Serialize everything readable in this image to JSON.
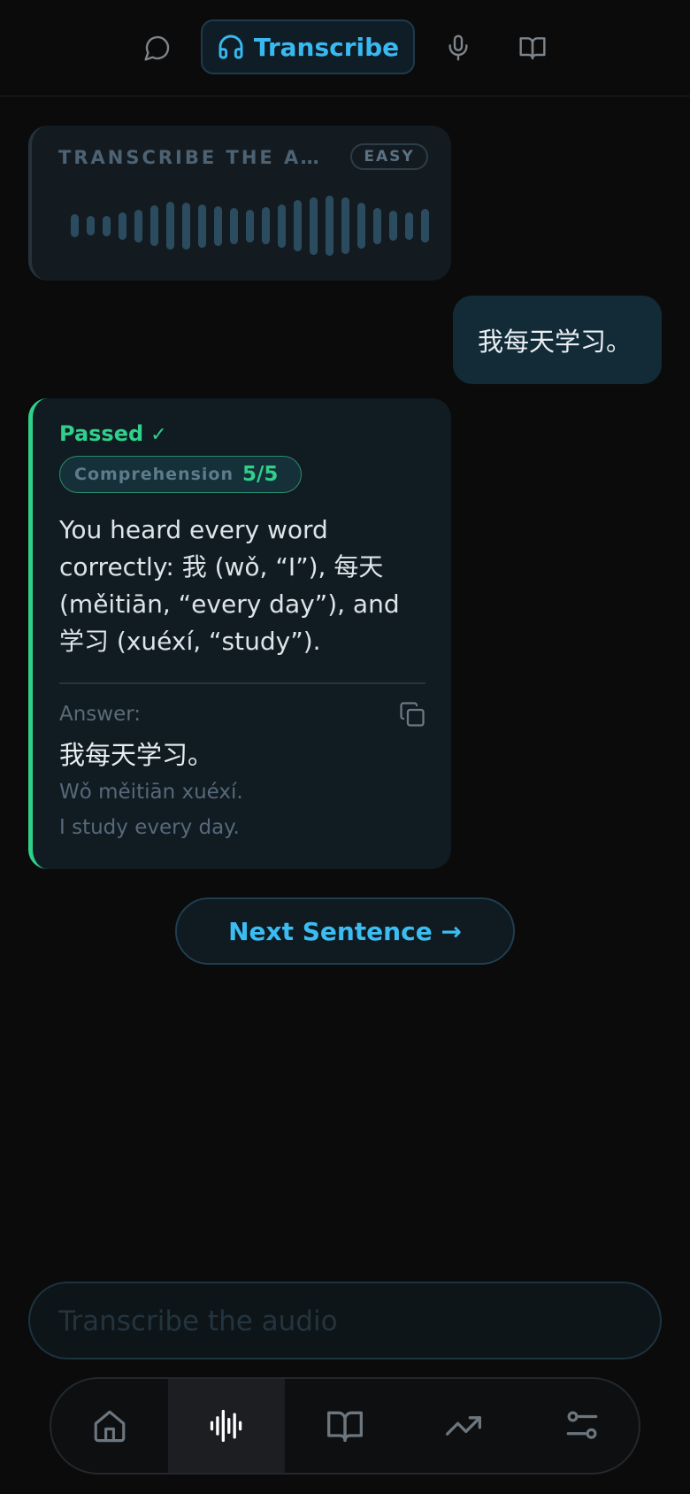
{
  "top_nav": {
    "items": [
      {
        "id": "chat",
        "icon": "chat-bubble-icon"
      },
      {
        "id": "transcribe",
        "icon": "headphones-icon",
        "label": "Transcribe",
        "active": true
      },
      {
        "id": "speak",
        "icon": "microphone-icon"
      },
      {
        "id": "read",
        "icon": "book-icon"
      }
    ]
  },
  "audio_card": {
    "title": "TRANSCRIBE THE AUDIO",
    "difficulty": "EASY",
    "waveform_levels": [
      0.38,
      0.32,
      0.34,
      0.45,
      0.55,
      0.68,
      0.8,
      0.78,
      0.72,
      0.66,
      0.6,
      0.55,
      0.62,
      0.72,
      0.86,
      0.96,
      1.0,
      0.94,
      0.76,
      0.6,
      0.5,
      0.46,
      0.56
    ]
  },
  "user_message": "我每天学习。",
  "result": {
    "status": "Passed",
    "status_mark": "✓",
    "metric_label": "Comprehension",
    "metric_score": "5/5",
    "feedback": "You heard every word correctly: 我 (wǒ, “I”), 每天 (měitiān, “every day”), and 学习 (xuéxí, “study”).",
    "answer_label": "Answer:",
    "answer_text": "我每天学习。",
    "answer_pinyin": "Wǒ měitiān xuéxí.",
    "answer_translation": "I study every day."
  },
  "next_button_label": "Next Sentence →",
  "input": {
    "placeholder": "Transcribe the audio",
    "value": ""
  },
  "bottom_nav": {
    "items": [
      {
        "id": "home",
        "icon": "home-icon"
      },
      {
        "id": "audio",
        "icon": "audio-waveform-icon",
        "active": true
      },
      {
        "id": "library",
        "icon": "book-icon"
      },
      {
        "id": "progress",
        "icon": "trending-up-icon"
      },
      {
        "id": "settings",
        "icon": "sliders-icon"
      }
    ]
  },
  "colors": {
    "background": "#0b0b0b",
    "accent_blue": "#39b9f0",
    "success_green": "#2fd08a",
    "card": "#111b22"
  }
}
